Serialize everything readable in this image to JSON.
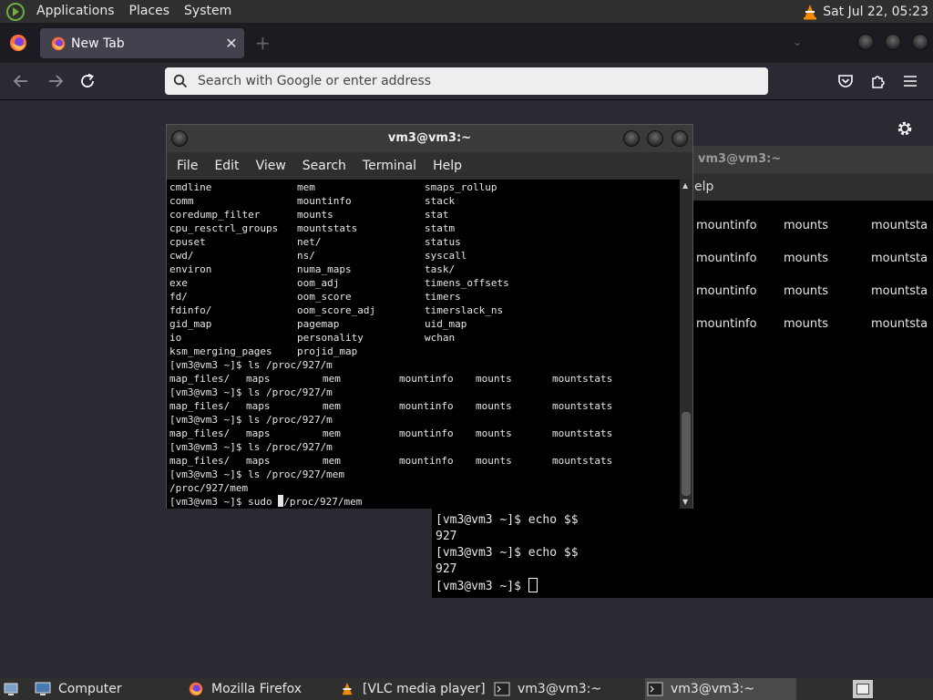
{
  "top_panel": {
    "menus": [
      "Applications",
      "Places",
      "System"
    ],
    "clock": "Sat Jul 22, 05:23",
    "tray_icons": [
      "vlc-icon"
    ]
  },
  "firefox": {
    "tab_title": "New Tab",
    "tab_close": "✕",
    "new_tab_symbol": "+",
    "list_all_tabs_symbol": "⌄",
    "url_placeholder": "Search with Google or enter address",
    "nav_icons": [
      "back-icon",
      "forward-icon",
      "reload-icon",
      "pocket-icon",
      "extensions-icon",
      "menu-icon"
    ],
    "colors": {
      "toolbar": "#2b2a33",
      "tabbar": "#1c1b22",
      "tab": "#42414d"
    }
  },
  "back_terminal": {
    "title": "vm3@vm3:~",
    "menu_fragment": "elp",
    "rows": [
      [
        "mountinfo",
        "mounts",
        "mountsta"
      ],
      [
        "mountinfo",
        "mounts",
        "mountsta"
      ],
      [
        "mountinfo",
        "mounts",
        "mountsta"
      ],
      [
        "mountinfo",
        "mounts",
        "mountsta"
      ]
    ],
    "bottom_lines": [
      "[vm3@vm3 ~]$ echo $$",
      "927",
      "[vm3@vm3 ~]$ echo $$",
      "927"
    ],
    "prompt": "[vm3@vm3 ~]$ "
  },
  "front_terminal": {
    "title": "vm3@vm3:~",
    "menu": [
      "File",
      "Edit",
      "View",
      "Search",
      "Terminal",
      "Help"
    ],
    "listing": [
      [
        "cmdline",
        "mem",
        "smaps_rollup"
      ],
      [
        "comm",
        "mountinfo",
        "stack"
      ],
      [
        "coredump_filter",
        "mounts",
        "stat"
      ],
      [
        "cpu_resctrl_groups",
        "mountstats",
        "statm"
      ],
      [
        "cpuset",
        "net/",
        "status"
      ],
      [
        "cwd/",
        "ns/",
        "syscall"
      ],
      [
        "environ",
        "numa_maps",
        "task/"
      ],
      [
        "exe",
        "oom_adj",
        "timens_offsets"
      ],
      [
        "fd/",
        "oom_score",
        "timers"
      ],
      [
        "fdinfo/",
        "oom_score_adj",
        "timerslack_ns"
      ],
      [
        "gid_map",
        "pagemap",
        "uid_map"
      ],
      [
        "io",
        "personality",
        "wchan"
      ],
      [
        "ksm_merging_pages",
        "projid_map",
        ""
      ]
    ],
    "prompt_m": "[vm3@vm3 ~]$ ls /proc/927/m",
    "map_row": [
      "map_files/",
      "maps",
      "mem",
      "mountinfo",
      "mounts",
      "mountstats"
    ],
    "prompt_mem": "[vm3@vm3 ~]$ ls /proc/927/mem",
    "mem_result": "/proc/927/mem",
    "sudo_prefix": "[vm3@vm3 ~]$ sudo ",
    "sudo_suffix": "/proc/927/mem",
    "scroll_up": "▲",
    "scroll_down": "▼"
  },
  "taskbar": {
    "items": [
      "Computer",
      "Mozilla Firefox",
      "[VLC media player]",
      "vm3@vm3:~",
      "vm3@vm3:~"
    ]
  }
}
